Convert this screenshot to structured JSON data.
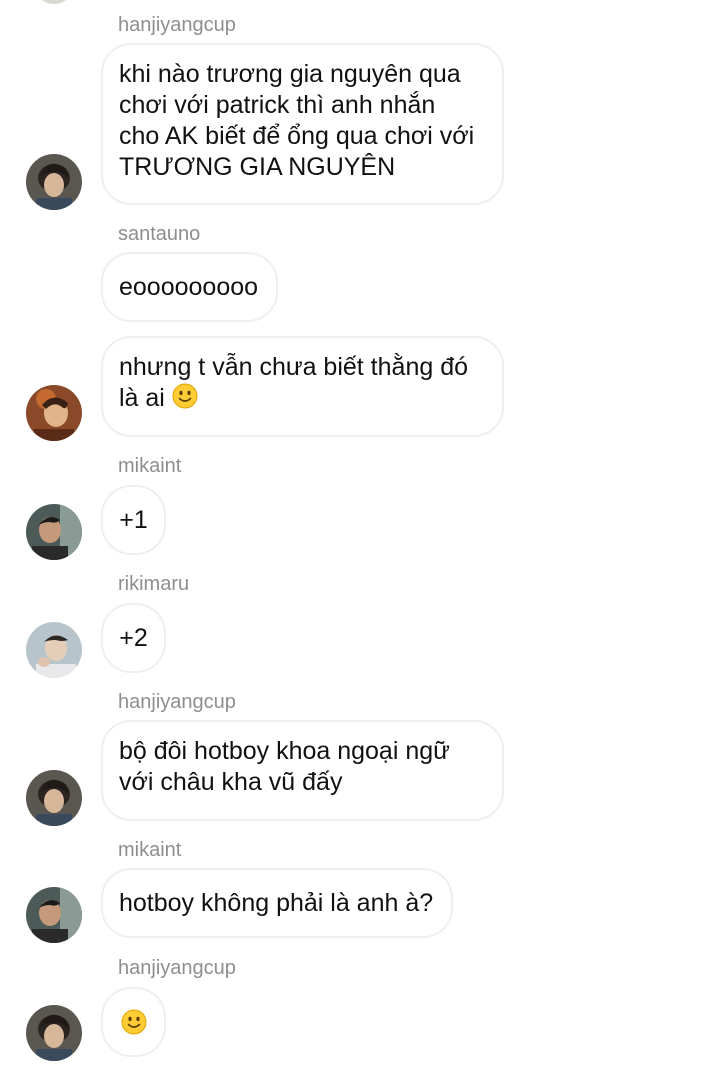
{
  "messages": [
    {
      "username": "hanjiyangcup",
      "lines": [
        "khi nào trương gia nguyên qua",
        "chơi với patrick thì anh nhắn",
        "cho AK biết để ổng qua chơi với",
        "TRƯƠNG GIA NGUYÊN"
      ]
    },
    {
      "username": "santauno",
      "lines": [
        "eooooooooo"
      ]
    },
    {
      "lines": [
        "nhưng t vẫn chưa biết thằng đó",
        "là ai"
      ],
      "trailing_emoji": "slightly-smiling-face"
    },
    {
      "username": "mikaint",
      "lines": [
        "+1"
      ]
    },
    {
      "username": "rikimaru",
      "lines": [
        "+2"
      ]
    },
    {
      "username": "hanjiyangcup",
      "lines": [
        "bộ đôi hotboy khoa ngoại ngữ",
        "với châu kha vũ đấy"
      ]
    },
    {
      "username": "mikaint",
      "lines": [
        "hotboy không phải là anh à?"
      ]
    },
    {
      "username": "hanjiyangcup",
      "emoji_only": "slightly-smiling-face"
    }
  ],
  "colors": {
    "background": "#ffffff",
    "bubble_border": "#efefef",
    "username_text": "#8e8e8e",
    "message_text": "#111111",
    "emoji_yellow": "#ffcc33"
  }
}
